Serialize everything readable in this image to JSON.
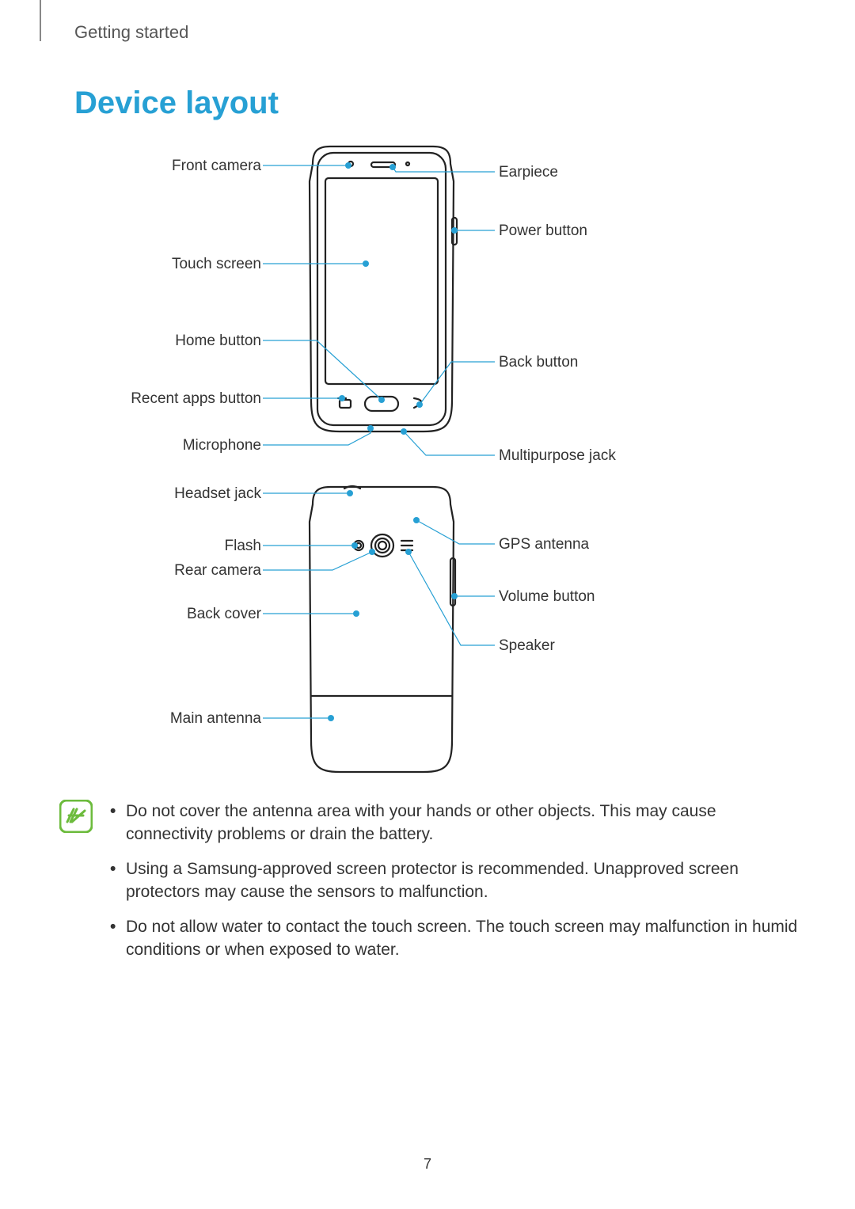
{
  "header": {
    "section": "Getting started"
  },
  "title": "Device layout",
  "pageNumber": "7",
  "front": {
    "leftLabels": {
      "frontCamera": "Front camera",
      "touchScreen": "Touch screen",
      "homeButton": "Home button",
      "recentApps": "Recent apps button",
      "microphone": "Microphone"
    },
    "rightLabels": {
      "earpiece": "Earpiece",
      "powerButton": "Power button",
      "backButton": "Back button",
      "multiJack": "Multipurpose jack"
    }
  },
  "back": {
    "leftLabels": {
      "headsetJack": "Headset jack",
      "flash": "Flash",
      "rearCamera": "Rear camera",
      "backCover": "Back cover",
      "mainAntenna": "Main antenna"
    },
    "rightLabels": {
      "gpsAntenna": "GPS antenna",
      "volumeButton": "Volume button",
      "speaker": "Speaker"
    }
  },
  "notes": {
    "antenna": "Do not cover the antenna area with your hands or other objects. This may cause connectivity problems or drain the battery.",
    "protector": "Using a Samsung-approved screen protector is recommended. Unapproved screen protectors may cause the sensors to malfunction.",
    "water": "Do not allow water to contact the touch screen. The touch screen may malfunction in humid conditions or when exposed to water."
  }
}
